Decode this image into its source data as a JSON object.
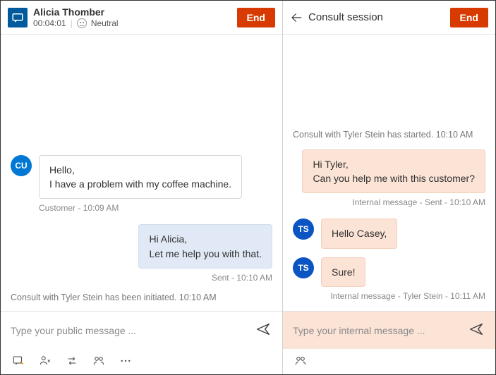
{
  "left": {
    "customerName": "Alicia Thomber",
    "timer": "00:04:01",
    "sentimentLabel": "Neutral",
    "endLabel": "End",
    "customerAvatar": "CU",
    "customerMessage": "Hello,\nI have a problem with my coffee machine.",
    "customerMeta": "Customer - 10:09 AM",
    "agentReply": "Hi Alicia,\nLet me help you with that.",
    "agentReplyMeta": "Sent - 10:10 AM",
    "consultInitiated": "Consult with Tyler Stein has been initiated. 10:10 AM",
    "inputPlaceholder": "Type your public message ..."
  },
  "right": {
    "title": "Consult session",
    "endLabel": "End",
    "consultStarted": "Consult with Tyler Stein has started. 10:10 AM",
    "outMsg": "Hi Tyler,\nCan you help me with this customer?",
    "outMeta": "Internal message - Sent - 10:10 AM",
    "tsAvatar": "TS",
    "tsMsg1": "Hello Casey,",
    "tsMsg2": "Sure!",
    "tsMeta": "Internal message - Tyler Stein - 10:11 AM",
    "inputPlaceholder": "Type your internal message ..."
  }
}
